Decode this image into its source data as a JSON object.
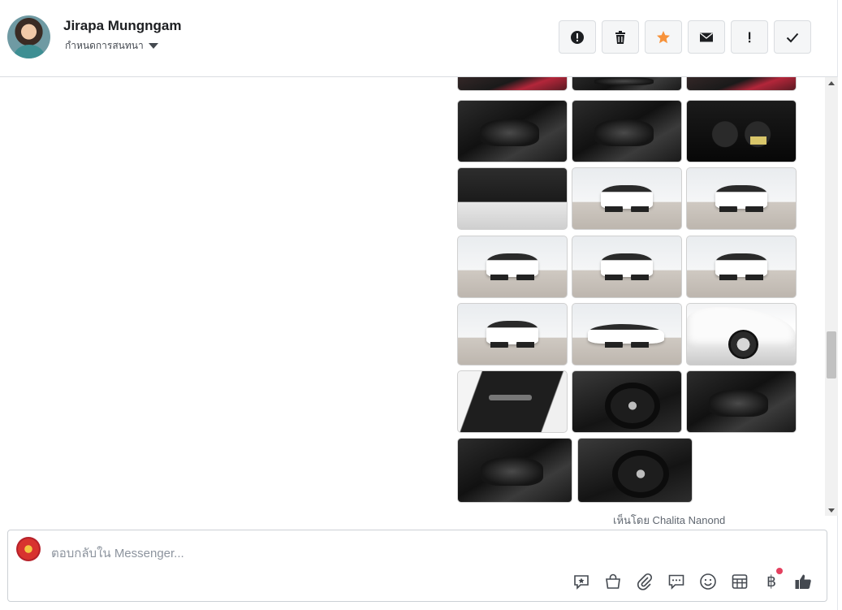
{
  "header": {
    "contact_name": "Jirapa Mungngam",
    "assign_label": "กำหนดการสนทนา",
    "actions": [
      {
        "name": "report-spam-button",
        "icon": "exclamation-circle-icon"
      },
      {
        "name": "delete-button",
        "icon": "trash-icon"
      },
      {
        "name": "star-button",
        "icon": "star-icon",
        "color": "#f7923a"
      },
      {
        "name": "mark-unread-button",
        "icon": "envelope-icon"
      },
      {
        "name": "follow-up-button",
        "icon": "exclamation-icon"
      },
      {
        "name": "mark-done-button",
        "icon": "checkmark-icon"
      }
    ]
  },
  "conversation": {
    "photos_description_count": 20,
    "seen_text": "เห็นโดย Chalita Nanond"
  },
  "composer": {
    "placeholder": "ตอบกลับใน Messenger...",
    "tools": [
      "saved-reply-icon",
      "shopping-bag-icon",
      "attachment-icon",
      "chat-bubble-icon",
      "emoji-icon",
      "table-icon",
      "baht-icon",
      "like-icon"
    ],
    "baht_symbol": "฿"
  }
}
